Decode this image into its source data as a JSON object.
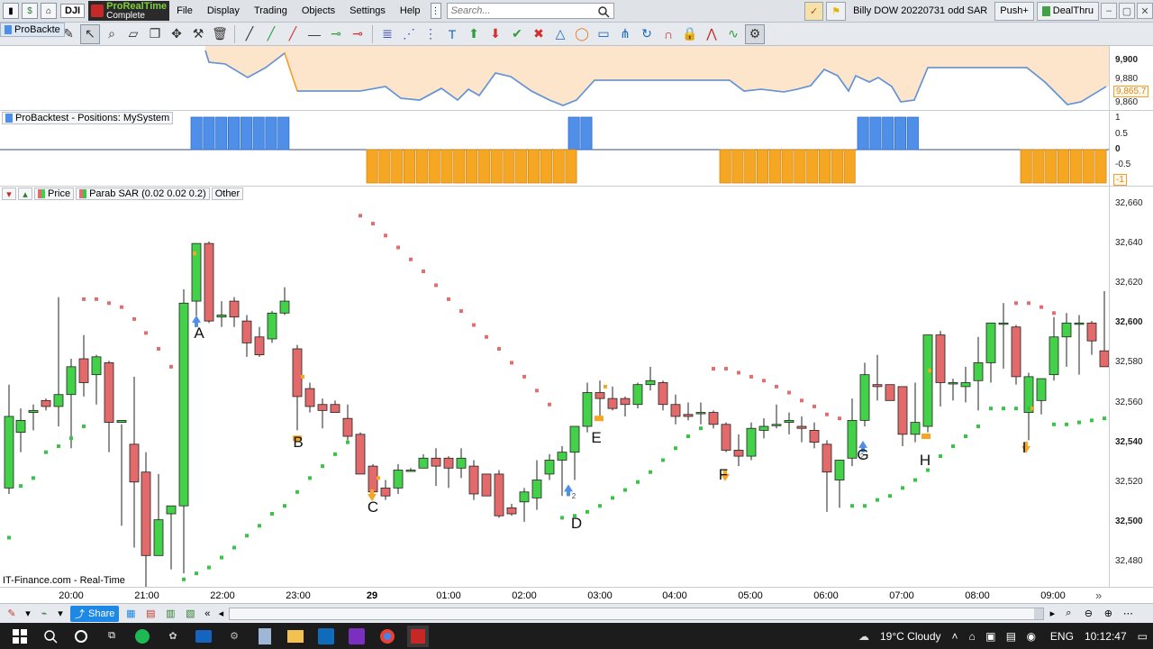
{
  "menubar": {
    "ticker": "DJI",
    "brand_line1": "ProRealTime",
    "brand_line2": "Complete",
    "menu": [
      "File",
      "Display",
      "Trading",
      "Objects",
      "Settings",
      "Help"
    ],
    "search_placeholder": "Search...",
    "workspace": "Billy DOW 20220731 odd SAR",
    "push_label": "Push+",
    "dealthru_label": "DealThru"
  },
  "toolbar": {
    "tab_label": "ProBackte",
    "icons": [
      "pencil-icon",
      "cursor-icon",
      "zoom-icon",
      "ruler-icon",
      "copy-icon",
      "move-icon",
      "tools-icon",
      "trash-icon",
      "line-icon",
      "green-line-icon",
      "red-line-icon",
      "hline-icon",
      "green-segment-icon",
      "red-segment-icon",
      "fib-icon",
      "fan-icon",
      "fib-time-icon",
      "text-icon",
      "buy-arrow-icon",
      "sell-arrow-icon",
      "check-icon",
      "cross-icon",
      "triangle-icon",
      "ellipse-icon",
      "rectangle-icon",
      "pitchfork-icon",
      "cycle-icon",
      "magnet-icon",
      "lock-icon",
      "zigzag-icon",
      "wave-icon",
      "settings-icon"
    ]
  },
  "equity_panel": {
    "ticks": [
      "9,900",
      "9,880",
      "9,865.7",
      "9,860"
    ],
    "line_color": "#5b95e6",
    "fill_color": "#fde5cc",
    "orange_line": "#f0a030"
  },
  "positions_panel": {
    "title": "ProBacktest - Positions: MySystem",
    "ticks": [
      "1",
      "0.5",
      "0",
      "-0.5",
      "-1"
    ],
    "long_color": "#4f8fe8",
    "short_color": "#f5a623"
  },
  "price_panel": {
    "labels": [
      "Price",
      "Parab SAR (0.02 0.02 0.2)",
      "Other"
    ],
    "ticks": [
      "32,660",
      "32,640",
      "32,620",
      "32,600",
      "32,580",
      "32,560",
      "32,540",
      "32,520",
      "32,500",
      "32,480"
    ],
    "bold_ticks": [
      "32,600",
      "32,540",
      "32,500"
    ],
    "source": "IT-Finance.com - Real-Time",
    "up_color": "#44d14a",
    "down_color": "#e36a6a",
    "sar_up_color": "#3cc24a",
    "sar_down_color": "#e07070",
    "annotations": [
      "A",
      "B",
      "C",
      "D",
      "E",
      "F",
      "G",
      "H",
      "I"
    ],
    "marker_counts": [
      "2",
      "2",
      "2"
    ]
  },
  "chart_data": {
    "type": "candlestick",
    "note_letters": [
      "A",
      "B",
      "C",
      "D",
      "E",
      "F",
      "G",
      "H",
      "I"
    ],
    "x_ticks": [
      "20:00",
      "21:00",
      "22:00",
      "23:00",
      "29",
      "01:00",
      "02:00",
      "03:00",
      "04:00",
      "05:00",
      "06:00",
      "07:00",
      "08:00",
      "09:00"
    ],
    "y_range": [
      32470,
      32665
    ]
  },
  "time_axis": {
    "labels": [
      "20:00",
      "21:00",
      "22:00",
      "23:00",
      "29",
      "01:00",
      "02:00",
      "03:00",
      "04:00",
      "05:00",
      "06:00",
      "07:00",
      "08:00",
      "09:00"
    ],
    "scroll_right": "»"
  },
  "bottombar": {
    "share_label": "Share"
  },
  "taskbar": {
    "weather": "19°C  Cloudy",
    "lang": "ENG",
    "time": "10:12:47"
  }
}
